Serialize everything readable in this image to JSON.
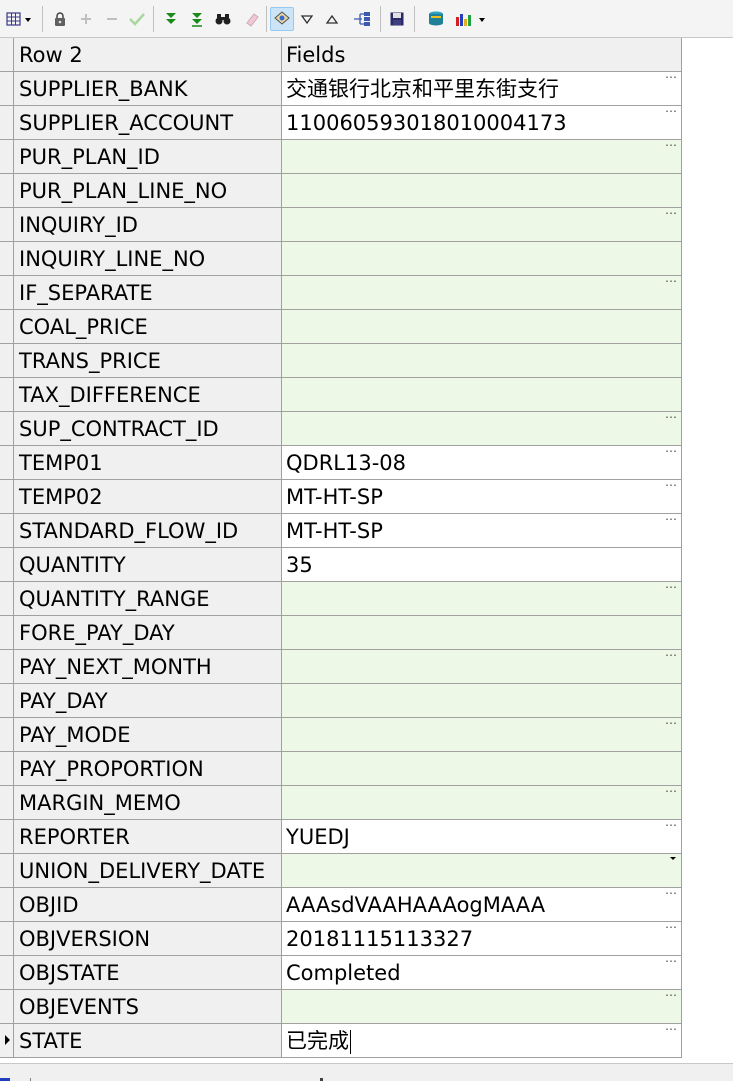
{
  "toolbar": {
    "buttons": [
      {
        "name": "grid-view-icon",
        "enabled": true
      },
      {
        "name": "lock-icon",
        "enabled": true
      },
      {
        "name": "add-icon",
        "enabled": false
      },
      {
        "name": "remove-icon",
        "enabled": false
      },
      {
        "name": "check-icon",
        "enabled": false
      },
      {
        "name": "sort-desc-icon",
        "enabled": true
      },
      {
        "name": "filter-down-icon",
        "enabled": true
      },
      {
        "name": "binoculars-icon",
        "enabled": true
      },
      {
        "name": "eraser-icon",
        "enabled": false
      },
      {
        "name": "refresh-icon",
        "enabled": true,
        "active": true
      },
      {
        "name": "triangle-down-icon",
        "enabled": true
      },
      {
        "name": "triangle-up-icon",
        "enabled": true
      },
      {
        "name": "tree-icon",
        "enabled": true
      },
      {
        "name": "save-icon",
        "enabled": true
      },
      {
        "name": "database-icon",
        "enabled": true
      },
      {
        "name": "chart-icon",
        "enabled": true
      }
    ]
  },
  "grid": {
    "header": {
      "name_col": "Row 2",
      "value_col": "Fields"
    },
    "rows": [
      {
        "name": "SUPPLIER_BANK",
        "value": "交通银行北京和平里东街支行"
      },
      {
        "name": "SUPPLIER_ACCOUNT",
        "value": "110060593018010004173"
      },
      {
        "name": "PUR_PLAN_ID",
        "value": ""
      },
      {
        "name": "PUR_PLAN_LINE_NO",
        "value": ""
      },
      {
        "name": "INQUIRY_ID",
        "value": ""
      },
      {
        "name": "INQUIRY_LINE_NO",
        "value": ""
      },
      {
        "name": "IF_SEPARATE",
        "value": ""
      },
      {
        "name": "COAL_PRICE",
        "value": ""
      },
      {
        "name": "TRANS_PRICE",
        "value": ""
      },
      {
        "name": "TAX_DIFFERENCE",
        "value": ""
      },
      {
        "name": "SUP_CONTRACT_ID",
        "value": ""
      },
      {
        "name": "TEMP01",
        "value": "QDRL13-08"
      },
      {
        "name": "TEMP02",
        "value": "MT-HT-SP"
      },
      {
        "name": "STANDARD_FLOW_ID",
        "value": "MT-HT-SP"
      },
      {
        "name": "QUANTITY",
        "value": "35"
      },
      {
        "name": "QUANTITY_RANGE",
        "value": ""
      },
      {
        "name": "FORE_PAY_DAY",
        "value": ""
      },
      {
        "name": "PAY_NEXT_MONTH",
        "value": ""
      },
      {
        "name": "PAY_DAY",
        "value": ""
      },
      {
        "name": "PAY_MODE",
        "value": ""
      },
      {
        "name": "PAY_PROPORTION",
        "value": ""
      },
      {
        "name": "MARGIN_MEMO",
        "value": ""
      },
      {
        "name": "REPORTER",
        "value": "YUEDJ"
      },
      {
        "name": "UNION_DELIVERY_DATE",
        "value": ""
      },
      {
        "name": "OBJID",
        "value": "AAAsdVAAHAAAogMAAA"
      },
      {
        "name": "OBJVERSION",
        "value": "20181115113327"
      },
      {
        "name": "OBJSTATE",
        "value": "Completed"
      },
      {
        "name": "OBJEVENTS",
        "value": ""
      },
      {
        "name": "STATE",
        "value": "已完成"
      }
    ]
  },
  "colors": {
    "empty_cell": "#eef8e6",
    "header_bg": "#f0f0f0",
    "grid_line": "#a0a0a0"
  }
}
